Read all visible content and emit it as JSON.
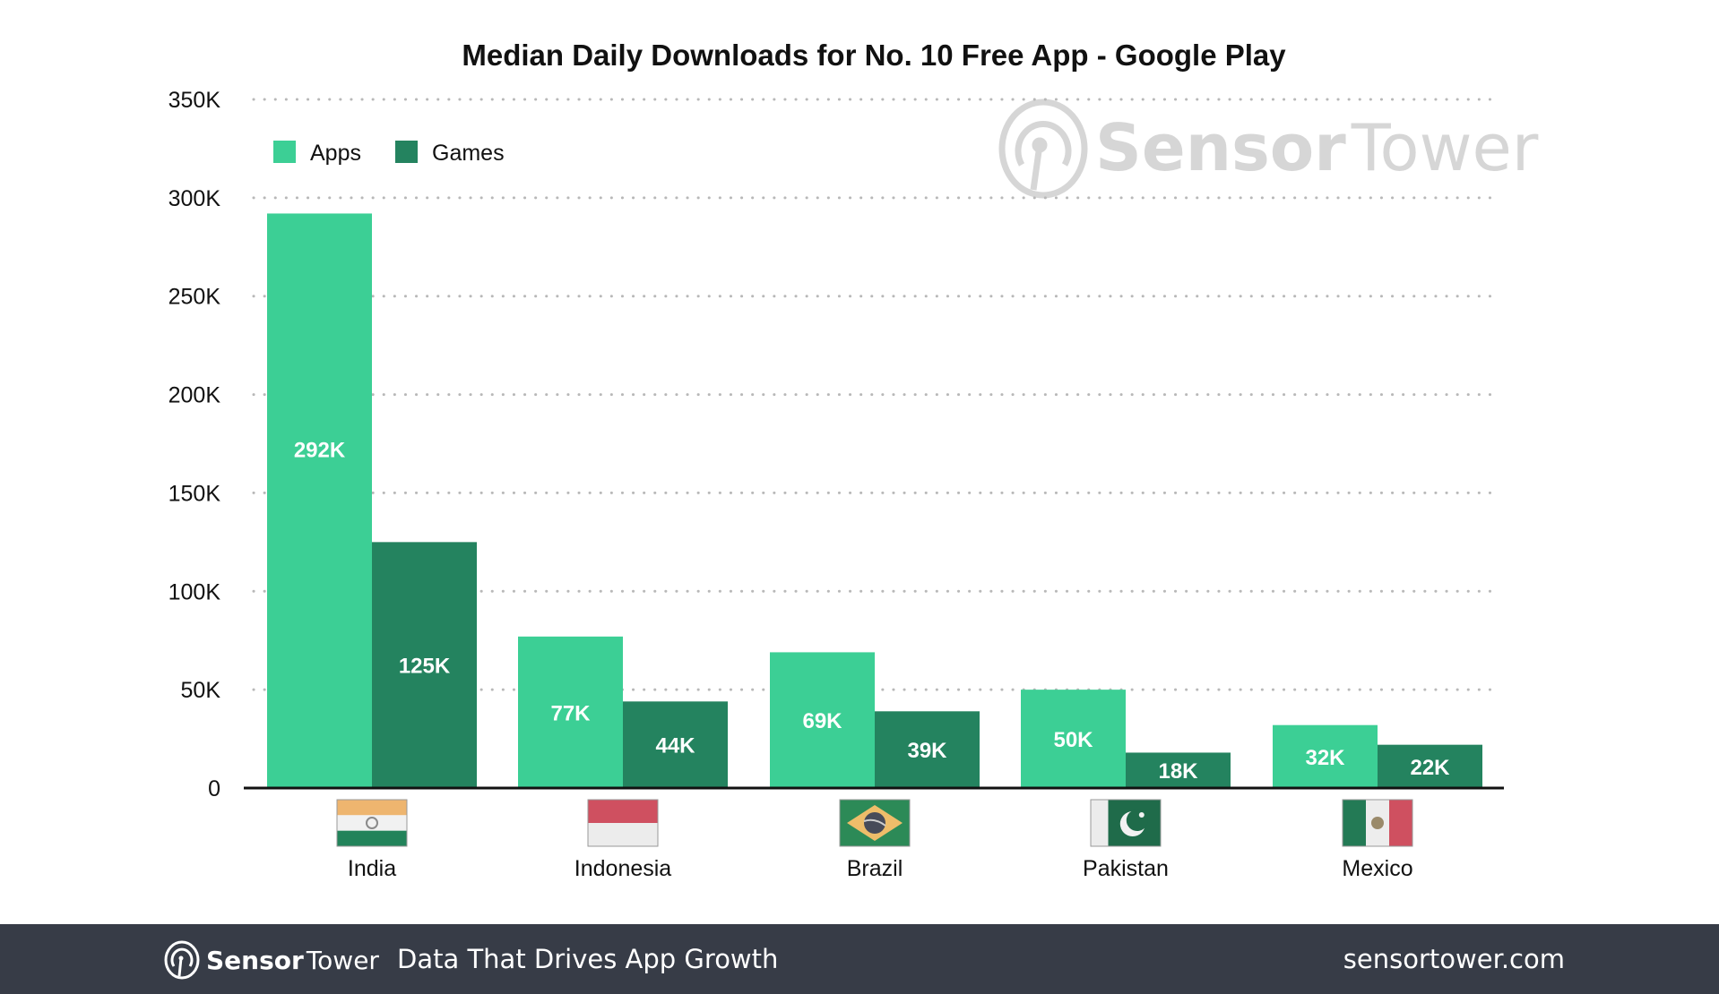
{
  "chart_data": {
    "type": "bar",
    "title": "Median Daily Downloads for No. 10 Free App - Google Play",
    "xlabel": "",
    "ylabel": "",
    "categories": [
      "India",
      "Indonesia",
      "Brazil",
      "Pakistan",
      "Mexico"
    ],
    "series": [
      {
        "name": "Apps",
        "color": "#3ccf95",
        "values": [
          292000,
          77000,
          69000,
          50000,
          32000
        ],
        "labels": [
          "292K",
          "77K",
          "69K",
          "50K",
          "32K"
        ]
      },
      {
        "name": "Games",
        "color": "#24835f",
        "values": [
          125000,
          44000,
          39000,
          18000,
          22000
        ],
        "labels": [
          "125K",
          "44K",
          "39K",
          "18K",
          "22K"
        ]
      }
    ],
    "ylim": [
      0,
      350000
    ],
    "yticks": [
      0,
      50000,
      100000,
      150000,
      200000,
      250000,
      300000,
      350000
    ],
    "ytick_labels": [
      "0",
      "50K",
      "100K",
      "150K",
      "200K",
      "250K",
      "300K",
      "350K"
    ],
    "grid": true,
    "legend": "top-left",
    "flags": [
      "india-flag",
      "indonesia-flag",
      "brazil-flag",
      "pakistan-flag",
      "mexico-flag"
    ]
  },
  "watermark": {
    "bold": "Sensor",
    "light": "Tower"
  },
  "footer": {
    "logo_bold": "Sensor",
    "logo_light": "Tower",
    "tagline": "Data That Drives App Growth",
    "site": "sensortower.com"
  }
}
